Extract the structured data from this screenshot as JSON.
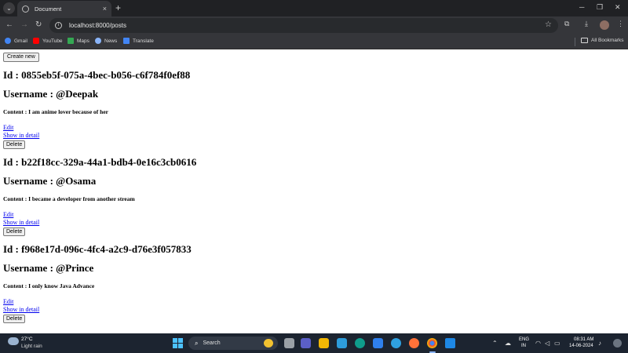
{
  "browser": {
    "tab_title": "Document",
    "tab_close": "×",
    "new_tab": "+",
    "url": "localhost:8000/posts",
    "bookmarks": [
      {
        "label": "Gmail",
        "color": "#4285f4"
      },
      {
        "label": "YouTube",
        "color": "#ff0000"
      },
      {
        "label": "Maps",
        "color": "#34a853"
      },
      {
        "label": "News",
        "color": "#8ab4f8"
      },
      {
        "label": "Translate",
        "color": "#4285f4"
      }
    ],
    "all_bookmarks": "All Bookmarks"
  },
  "page": {
    "create_button": "Create new",
    "posts": [
      {
        "id_line": "Id : 0855eb5f-075a-4bec-b056-c6f784f0ef88",
        "username_line": "Username : @Deepak",
        "content_line": "Content : I am anime lover because of her",
        "edit": "Edit",
        "show": "Show in detail",
        "delete": "Delete"
      },
      {
        "id_line": "Id : b22f18cc-329a-44a1-bdb4-0e16c3cb0616",
        "username_line": "Username : @Osama",
        "content_line": "Content : I became a developer from another stream",
        "edit": "Edit",
        "show": "Show in detail",
        "delete": "Delete"
      },
      {
        "id_line": "Id : f968e17d-096c-4fc4-a2c9-d76e3f057833",
        "username_line": "Username : @Prince",
        "content_line": "Content : I only know Java Advance",
        "edit": "Edit",
        "show": "Show in detail",
        "delete": "Delete"
      }
    ]
  },
  "taskbar": {
    "weather_temp": "27°C",
    "weather_desc": "Light rain",
    "search_label": "Search",
    "lang_line1": "ENG",
    "lang_line2": "IN",
    "time": "08:31 AM",
    "date": "14-06-2024"
  }
}
